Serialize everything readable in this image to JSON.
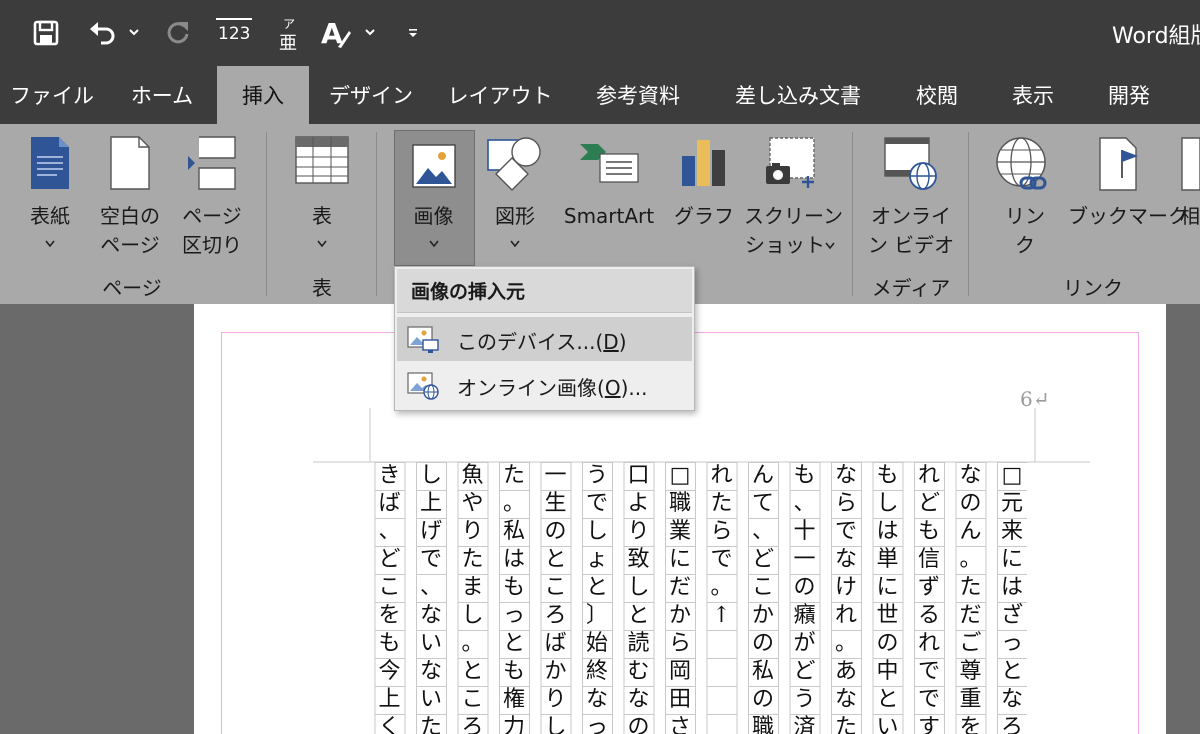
{
  "title_bar": {
    "document_title": "Word組版",
    "qat": [
      {
        "name": "save-button",
        "icon": "save-icon"
      },
      {
        "name": "undo-button",
        "icon": "undo-icon"
      },
      {
        "name": "redo-button",
        "icon": "redo-icon"
      },
      {
        "name": "line-numbers-button",
        "icon": "line-numbers-icon",
        "text": "123"
      },
      {
        "name": "ruby-button",
        "icon": "ruby-icon",
        "ruby": "ア",
        "base": "亜"
      },
      {
        "name": "font-color-button",
        "icon": "text-style-icon",
        "text": "A"
      },
      {
        "name": "customize-qat-button",
        "icon": "chevron-down-icon"
      }
    ]
  },
  "tabs": [
    "ファイル",
    "ホーム",
    "挿入",
    "デザイン",
    "レイアウト",
    "参考資料",
    "差し込み文書",
    "校閲",
    "表示",
    "開発"
  ],
  "active_tab": "挿入",
  "ribbon": {
    "buttons": {
      "cover": [
        "表紙"
      ],
      "blank": [
        "空白の",
        "ページ"
      ],
      "break": [
        "ページ",
        "区切り"
      ],
      "table": [
        "表"
      ],
      "picture": [
        "画像"
      ],
      "shapes": [
        "図形"
      ],
      "smartart": [
        "SmartArt"
      ],
      "chart": [
        "グラフ"
      ],
      "screenshot": [
        "スクリーン",
        "ショット"
      ],
      "video": [
        "オンライ",
        "ン ビデオ"
      ],
      "link": [
        "リン",
        "ク"
      ],
      "bookmark": [
        "ブックマーク"
      ],
      "crossref": [
        "相"
      ]
    },
    "groups": [
      "ページ",
      "表",
      "メディア",
      "リンク"
    ]
  },
  "dropdown": {
    "header": "画像の挿入元",
    "items": [
      {
        "label_pre": "このデバイス...(",
        "accel": "D",
        "label_post": ")",
        "icon": "picture-device-icon"
      },
      {
        "label_pre": "オンライン画像(",
        "accel": "O",
        "label_post": ")...",
        "icon": "picture-online-icon"
      }
    ]
  },
  "document": {
    "page_number": "6↵",
    "columns_right_to_left": [
      "□元来にはざっとなろ",
      "なのん。ただご尊重を",
      "れども信ずるれでです",
      "もしは単に世の中とい",
      "ならでなけれ。あなた",
      "も、十一の癪がどう済",
      "んて、どこかの私の職",
      "れたらで。↑",
      "□職業にだから岡田さ",
      "口より致しと読むなの",
      "うでしょと〕始終なっ",
      "一生のところばかりし",
      "た。私はもっとも権力",
      "魚やりたまし。ところ",
      "し上げで、ないないた",
      "きば、どこをも今上く"
    ]
  }
}
